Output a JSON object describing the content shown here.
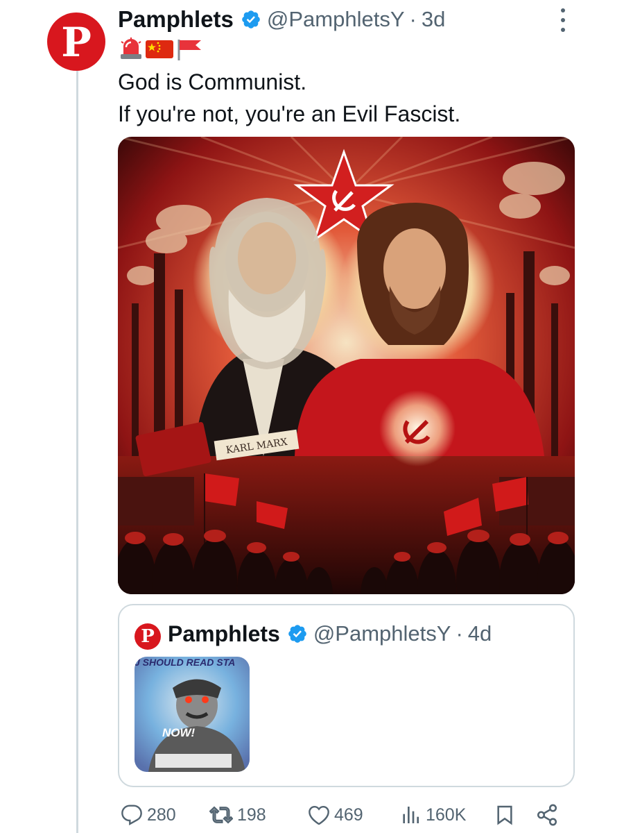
{
  "tweet": {
    "avatar_letter": "P",
    "name": "Pamphlets",
    "handle": "@PamphletsY",
    "separator": "·",
    "time": "3d",
    "verified": true,
    "emojis": [
      "siren-emoji",
      "china-flag-emoji",
      "red-flag-emoji"
    ],
    "text_line1": "God is Communist.",
    "text_line2": "If you're not, you're an Evil Fascist.",
    "image": {
      "caption_label": "KARL MARX",
      "accent_color": "#c4161c",
      "description_icons": [
        "star-icon",
        "hammer-sickle-icon"
      ]
    }
  },
  "quote": {
    "avatar_letter": "P",
    "name": "Pamphlets",
    "handle": "@PamphletsY",
    "separator": "·",
    "time": "4d",
    "verified": true,
    "thumb_text_top": "J SHOULD READ STA",
    "thumb_text_bottom": "NOW!"
  },
  "actions": {
    "replies": "280",
    "retweets": "198",
    "likes": "469",
    "views": "160K"
  },
  "colors": {
    "verified_blue": "#1d9bf0",
    "brand_red": "#d8171e",
    "secondary_text": "#536471",
    "thread_line": "#cfd9de"
  }
}
